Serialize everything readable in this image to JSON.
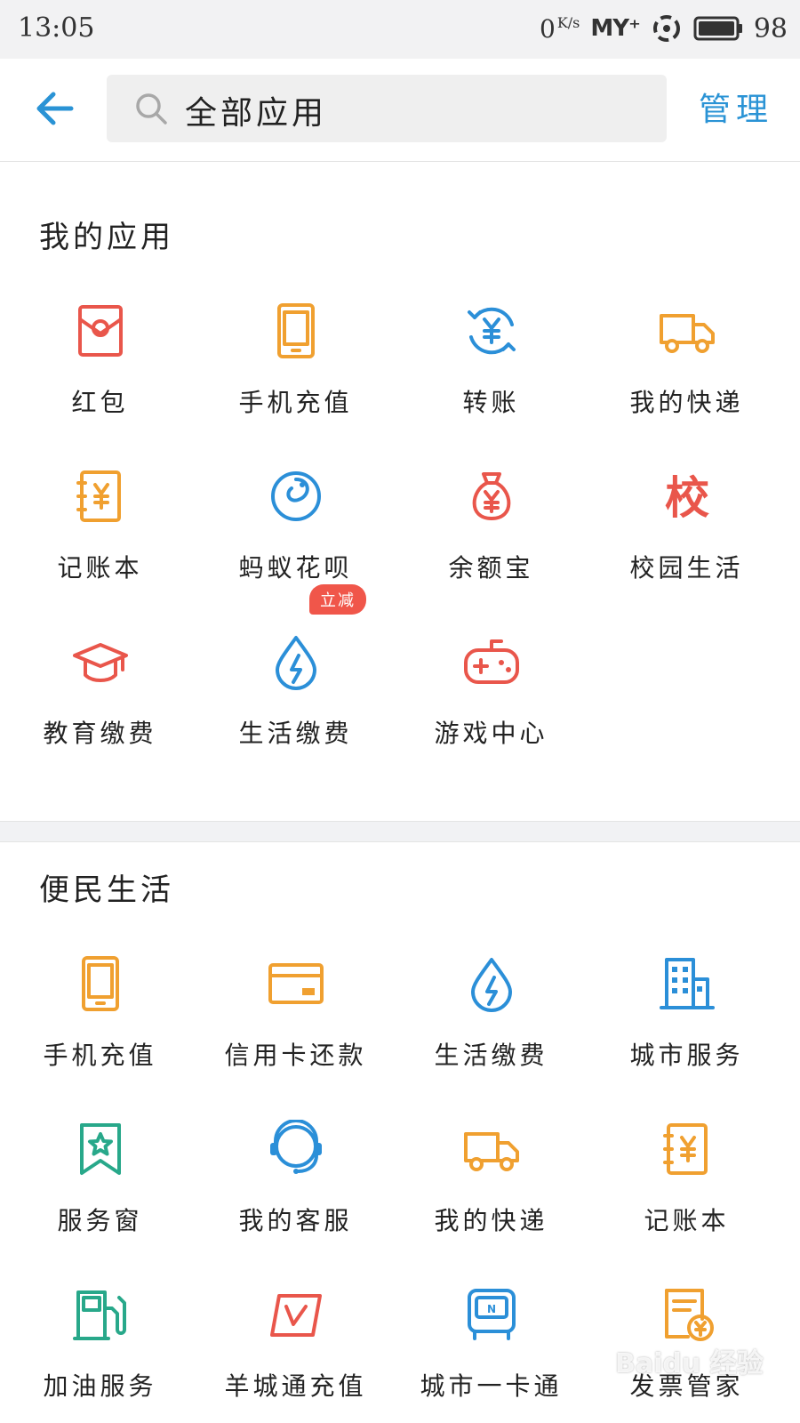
{
  "status_bar": {
    "time": "13:05",
    "net_speed": "0",
    "net_unit": "K/s",
    "carrier": "MY⁺",
    "battery": "98"
  },
  "header": {
    "search_text": "全部应用",
    "manage_label": "管理"
  },
  "sections": [
    {
      "title": "我的应用",
      "items": [
        {
          "label": "红包",
          "icon": "red-envelope-icon",
          "color": "#e9564b"
        },
        {
          "label": "手机充值",
          "icon": "phone-icon",
          "color": "#f0a030"
        },
        {
          "label": "转账",
          "icon": "transfer-icon",
          "color": "#2b8fd8"
        },
        {
          "label": "我的快递",
          "icon": "truck-icon",
          "color": "#f0a030"
        },
        {
          "label": "记账本",
          "icon": "ledger-icon",
          "color": "#f0a030"
        },
        {
          "label": "蚂蚁花呗",
          "icon": "huabei-icon",
          "color": "#2b8fd8"
        },
        {
          "label": "余额宝",
          "icon": "money-bag-icon",
          "color": "#e9564b"
        },
        {
          "label": "校园生活",
          "icon": "campus-icon",
          "icon_text": "校",
          "color": "#e9564b"
        },
        {
          "label": "教育缴费",
          "icon": "graduation-cap-icon",
          "color": "#e9564b"
        },
        {
          "label": "生活缴费",
          "icon": "water-drop-icon",
          "color": "#2b8fd8",
          "badge": "立减"
        },
        {
          "label": "游戏中心",
          "icon": "gamepad-icon",
          "color": "#e9564b"
        }
      ]
    },
    {
      "title": "便民生活",
      "items": [
        {
          "label": "手机充值",
          "icon": "phone-icon",
          "color": "#f0a030"
        },
        {
          "label": "信用卡还款",
          "icon": "credit-card-icon",
          "color": "#f0a030"
        },
        {
          "label": "生活缴费",
          "icon": "water-drop-icon",
          "color": "#2b8fd8"
        },
        {
          "label": "城市服务",
          "icon": "building-icon",
          "color": "#2b8fd8"
        },
        {
          "label": "服务窗",
          "icon": "star-bookmark-icon",
          "color": "#28a88a"
        },
        {
          "label": "我的客服",
          "icon": "headset-icon",
          "color": "#2b8fd8"
        },
        {
          "label": "我的快递",
          "icon": "truck-icon",
          "color": "#f0a030"
        },
        {
          "label": "记账本",
          "icon": "ledger-icon",
          "color": "#f0a030"
        },
        {
          "label": "加油服务",
          "icon": "gas-pump-icon",
          "color": "#28a88a"
        },
        {
          "label": "羊城通充值",
          "icon": "yct-card-icon",
          "color": "#e9564b"
        },
        {
          "label": "城市一卡通",
          "icon": "bus-card-icon",
          "color": "#2b8fd8"
        },
        {
          "label": "发票管家",
          "icon": "invoice-icon",
          "color": "#f0a030"
        }
      ]
    }
  ],
  "watermark": "Baidu 经验"
}
